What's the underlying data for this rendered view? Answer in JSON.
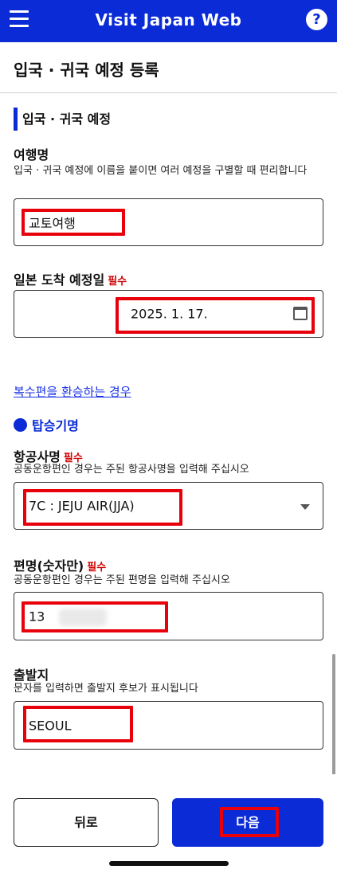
{
  "header": {
    "title": "Visit Japan Web",
    "help_glyph": "?",
    "menu_icon": "hamburger-menu-icon",
    "help_icon": "question-icon"
  },
  "page": {
    "title": "입국 · 귀국 예정 등록"
  },
  "section": {
    "title": "입국 · 귀국 예정"
  },
  "trip_name": {
    "label": "여행명",
    "help": "입국 · 귀국 예정에 이름을 붙이면 여러 예정을 구별할 때 편리합니다",
    "value": "교토여행"
  },
  "arrival_date": {
    "label": "일본 도착 예정일",
    "required": "필수",
    "value": "2025. 1. 17.",
    "icon": "calendar-icon"
  },
  "transfer_link": "복수편을 환승하는 경우",
  "flight": {
    "heading": "탑승기명",
    "airline": {
      "label": "항공사명",
      "required": "필수",
      "help": "공동운항편인 경우는 주된 항공사명을 입력해 주십시오",
      "selected": "7C : JEJU AIR(JJA)",
      "icon": "dropdown-caret-icon"
    },
    "flight_no": {
      "label": "편명(숫자만)",
      "required": "필수",
      "help": "공동운항편인 경우는 주된 편명을 입력해 주십시오",
      "value": "13"
    },
    "departure": {
      "label": "출발지",
      "help": "문자를 입력하면 출발지 후보가 표시됩니다",
      "value": "SEOUL"
    }
  },
  "footer": {
    "back_label": "뒤로",
    "next_label": "다음"
  },
  "colors": {
    "brand_blue": "#0a2bd6",
    "required_red": "#d00000",
    "highlight_red": "#e8000b",
    "link_blue": "#1a33e6"
  }
}
